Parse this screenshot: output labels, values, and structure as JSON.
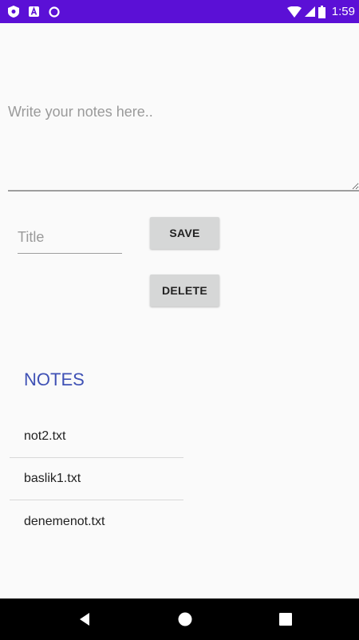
{
  "status_bar": {
    "time": "1:59",
    "left_icons": [
      "shield-icon",
      "a-icon",
      "circle-icon"
    ],
    "right_icons": [
      "wifi-icon",
      "signal-icon",
      "battery-icon"
    ],
    "background": "#5b10d6"
  },
  "notes_input": {
    "placeholder": "Write your notes here..",
    "value": ""
  },
  "title_input": {
    "placeholder": "Title",
    "value": ""
  },
  "buttons": {
    "save_label": "SAVE",
    "delete_label": "DELETE"
  },
  "notes_section": {
    "heading": "NOTES",
    "heading_color": "#3f51b5",
    "items": [
      {
        "label": "not2.txt"
      },
      {
        "label": "baslik1.txt"
      },
      {
        "label": "denemenot.txt"
      }
    ]
  },
  "nav_bar": {
    "icons": [
      "back-icon",
      "home-icon",
      "recents-icon"
    ]
  }
}
